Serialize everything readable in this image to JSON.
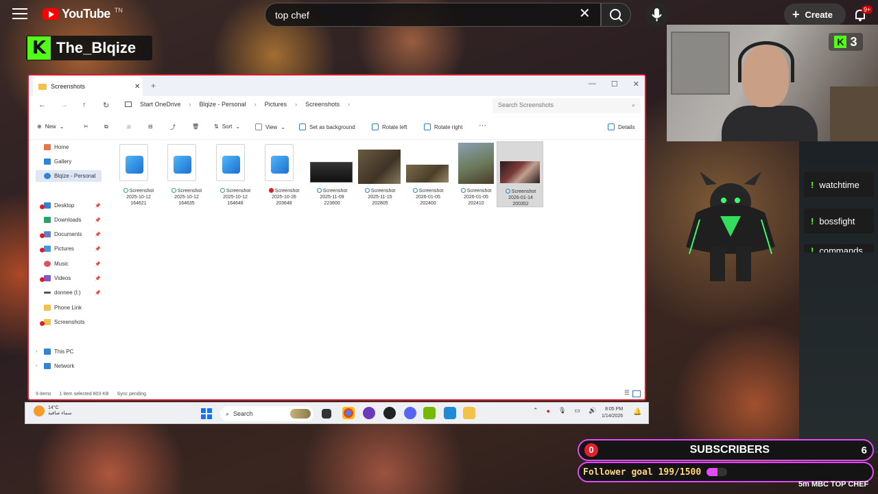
{
  "youtube": {
    "logo_text": "YouTube",
    "logo_sup": "TN",
    "search_value": "top chef",
    "create_label": "Create",
    "notif_badge": "9+"
  },
  "stream": {
    "logo_letter": "K",
    "name": "The_Blqize",
    "viewer_count": "3"
  },
  "commands": [
    "watchtime",
    "bossfight",
    "commands"
  ],
  "explorer": {
    "tab_title": "Screenshots",
    "breadcrumbs": [
      "Start OneDrive",
      "Blqize - Personal",
      "Pictures",
      "Screenshots"
    ],
    "search_placeholder": "Search Screenshots",
    "toolbar": {
      "new": "New",
      "sort": "Sort",
      "view": "View",
      "set_bg": "Set as background",
      "rotate_left": "Rotate left",
      "rotate_right": "Rotate right",
      "more": "···",
      "details": "Details"
    },
    "nav": [
      {
        "label": "Home",
        "icon": "home-icon"
      },
      {
        "label": "Gallery",
        "icon": "gallery-icon"
      },
      {
        "label": "Blqize - Personal",
        "icon": "cloud-icon"
      },
      {
        "label": "Desktop",
        "icon": "desktop-icon"
      },
      {
        "label": "Downloads",
        "icon": "downloads-icon"
      },
      {
        "label": "Documents",
        "icon": "documents-icon"
      },
      {
        "label": "Pictures",
        "icon": "pictures-icon"
      },
      {
        "label": "Music",
        "icon": "music-icon"
      },
      {
        "label": "Videos",
        "icon": "videos-icon"
      },
      {
        "label": "donnee (I:)",
        "icon": "drive-icon"
      },
      {
        "label": "Phone Link",
        "icon": "folder-icon"
      },
      {
        "label": "Screenshots",
        "icon": "folder-icon"
      },
      {
        "label": "This PC",
        "icon": "pc-icon"
      },
      {
        "label": "Network",
        "icon": "network-icon"
      }
    ],
    "files": [
      {
        "name": "Screenshot",
        "date": "2025-10-12",
        "time": "164621",
        "status": "ok"
      },
      {
        "name": "Screenshot",
        "date": "2025-10-12",
        "time": "164635",
        "status": "ok"
      },
      {
        "name": "Screenshot",
        "date": "2025-10-12",
        "time": "164648",
        "status": "ok"
      },
      {
        "name": "Screenshot",
        "date": "2025-10-26",
        "time": "203648",
        "status": "error"
      },
      {
        "name": "Screenshot",
        "date": "2025-11-09",
        "time": "223600",
        "status": "sync"
      },
      {
        "name": "Screenshot",
        "date": "2025-11-15",
        "time": "202805",
        "status": "sync"
      },
      {
        "name": "Screenshot",
        "date": "2026-01-05",
        "time": "202400",
        "status": "sync"
      },
      {
        "name": "Screenshot",
        "date": "2026-01-05",
        "time": "202410",
        "status": "sync"
      },
      {
        "name": "Screenshot",
        "date": "2026-01-14",
        "time": "200352",
        "status": "sync"
      }
    ],
    "status": {
      "items": "9 items",
      "selected": "1 item selected  803 KB",
      "sync": "Sync pending"
    }
  },
  "taskbar": {
    "temp": "14°C",
    "weather_desc": "سماء صافية",
    "search_label": "Search",
    "time": "8:05 PM",
    "date": "1/14/2026"
  },
  "widgets": {
    "subs_left": "0",
    "subs_title": "SUBSCRIBERS",
    "subs_right": "6",
    "goal_text": "Follower goal 199/1500",
    "goal_fraction": 0.133,
    "ticker": "5m MBC TOP CHEF"
  },
  "colors": {
    "kick_green": "#53fc18",
    "widget_border": "#e24bf5",
    "youtube_red": "#ff0000",
    "window_border": "#d81b2a"
  }
}
